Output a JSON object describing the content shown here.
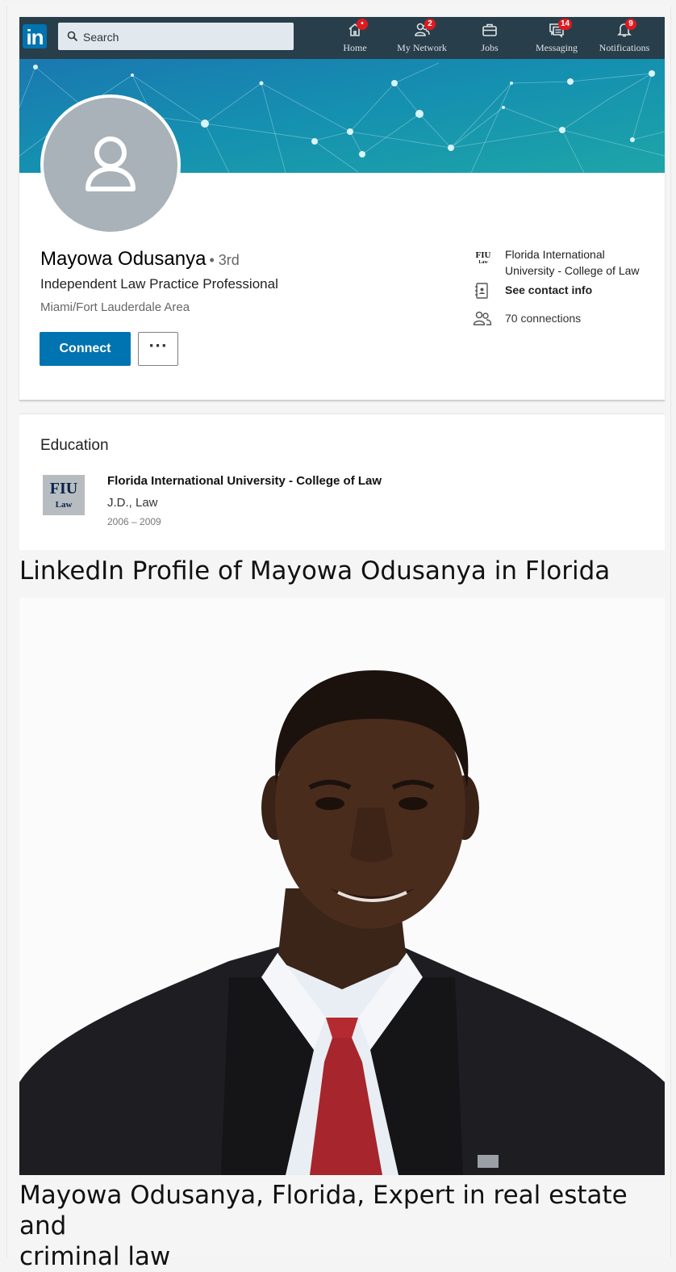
{
  "nav": {
    "logo_text": "in",
    "search_placeholder": "Search",
    "items": [
      {
        "label": "Home",
        "badge": "•",
        "icon": "home-icon"
      },
      {
        "label": "My Network",
        "badge": "2",
        "icon": "network-icon"
      },
      {
        "label": "Jobs",
        "badge": "",
        "icon": "briefcase-icon"
      },
      {
        "label": "Messaging",
        "badge": "14",
        "icon": "messaging-icon"
      },
      {
        "label": "Notifications",
        "badge": "9",
        "icon": "bell-icon"
      }
    ]
  },
  "profile": {
    "name": "Mayowa Odusanya",
    "degree": "• 3rd",
    "headline": "Independent Law Practice Professional",
    "location": "Miami/Fort Lauderdale Area",
    "connect_label": "Connect",
    "more_label": "···",
    "side": {
      "school_logo_text": "FIU",
      "school_logo_sub": "Law",
      "school_line1": "Florida International",
      "school_line2": "University - College of Law",
      "contact_label": "See contact info",
      "connections": "70 connections"
    }
  },
  "education": {
    "title": "Education",
    "logo_text": "FIU",
    "logo_sub": "Law",
    "school": "Florida International University - College of Law",
    "degree": "J.D., Law",
    "dates": "2006 – 2009"
  },
  "captions": {
    "screenshot": "LinkedIn Profile of Mayowa Odusanya in Florida",
    "photo_line1": "Mayowa Odusanya, Florida, Expert in real estate and",
    "photo_line2": "criminal law"
  },
  "colors": {
    "nav_bg": "#283e4a",
    "brand_blue": "#0073b1",
    "badge_red": "#e0191f",
    "banner_teal": "#1496b0"
  }
}
